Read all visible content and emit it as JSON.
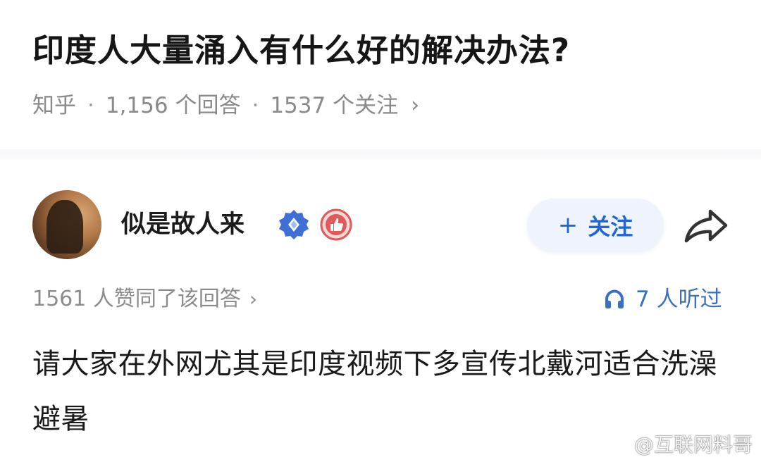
{
  "question": {
    "title": "印度人大量涌入有什么好的解决办法?",
    "source": "知乎",
    "separator": "·",
    "answers_count": "1,156 个回答",
    "followers_count": "1537 个关注",
    "chevron": "›"
  },
  "author": {
    "name": "似是故人来",
    "avatar_icon": "avatar-photo",
    "badges": [
      "verified-diamond-icon",
      "thumbs-up-creator-icon"
    ]
  },
  "actions": {
    "follow_plus": "+",
    "follow_label": "关注",
    "share_icon": "share-arrow-icon"
  },
  "stats": {
    "upvote_text": "1561 人赞同了该回答",
    "upvote_chevron": "›",
    "listen_text": "7 人听过",
    "listen_icon": "headphones-icon"
  },
  "answer": {
    "content": "请大家在外网尤其是印度视频下多宣传北戴河适合洗澡避暑"
  },
  "watermark": {
    "text": "@互联网料哥",
    "logo": "weibo-icon"
  },
  "colors": {
    "accent_blue": "#1f67d8",
    "follow_bg": "#eef3fc",
    "meta_gray": "#8a8a8a",
    "verified_blue": "#3d6fd6",
    "creator_red": "#e05a5a"
  }
}
